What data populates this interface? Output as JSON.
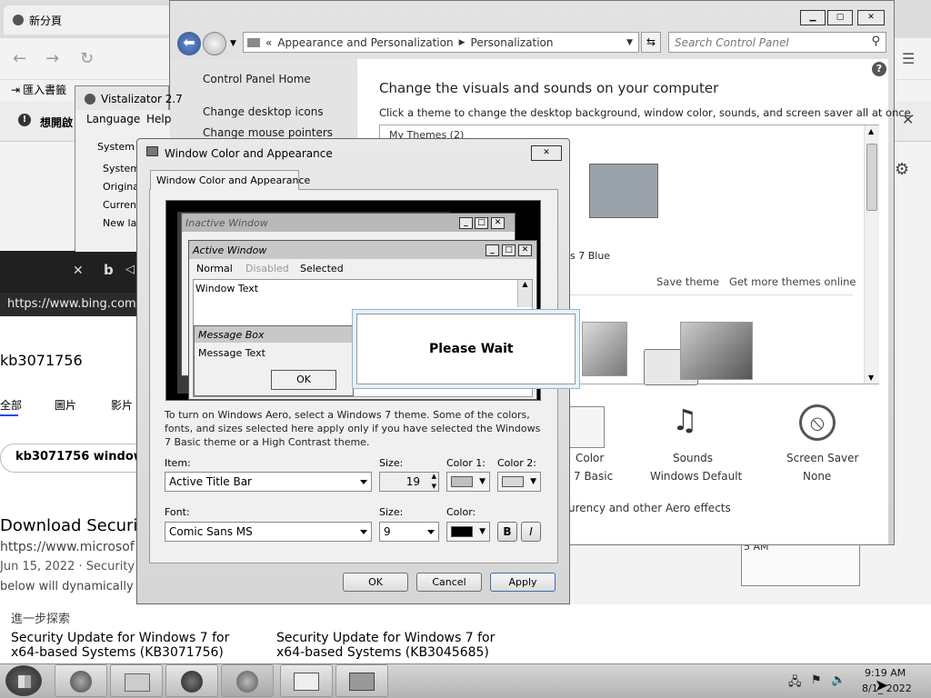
{
  "browser": {
    "tab_title": "新分頁",
    "import_bookmarks": "匯入書籤",
    "notice": "想開啟",
    "address_bar": "https://www.bing.com/",
    "search_query": "kb3071756",
    "tabs": [
      "全部",
      "圖片",
      "影片"
    ],
    "related_pill": "kb3071756 windows",
    "result_title": "Download Securit",
    "result_url": "https://www.microsof",
    "result_date": "Jun 15, 2022 · Security U",
    "result_snippet": "below will dynamically ch",
    "explore_label": "進一步探索",
    "links": [
      "Security Update for Windows 7 for x64-based Systems (KB3071756)",
      "Security Update for Windows 7 for x64-based Systems (KB3045685)"
    ]
  },
  "vistalizator": {
    "title": "Vistalizator 2.7",
    "menu": [
      "Language",
      "Help"
    ],
    "group_label": "System c",
    "rows": [
      "System:",
      "Origina",
      "Current",
      "New lan"
    ]
  },
  "control_panel": {
    "breadcrumb": [
      "Appearance and Personalization",
      "Personalization"
    ],
    "search_placeholder": "Search Control Panel",
    "sidebar": [
      "Control Panel Home",
      "Change desktop icons",
      "Change mouse pointers"
    ],
    "heading": "Change the visuals and sounds on your computer",
    "description": "Click a theme to change the desktop background, window color, sounds, and screen saver all at once.",
    "my_themes": "My Themes (2)",
    "theme_name": "ws 7 Blue",
    "save_theme": "Save theme",
    "get_more": "Get more themes online",
    "bottom_items": [
      {
        "label": "Color",
        "sub": "7 Basic"
      },
      {
        "label": "Sounds",
        "sub": "Windows Default"
      },
      {
        "label": "Screen Saver",
        "sub": "None"
      }
    ],
    "transparency": "urency and other Aero effects",
    "back_window_time": "5 AM"
  },
  "dialog": {
    "title": "Window Color and Appearance",
    "tab": "Window Color and Appearance",
    "preview": {
      "inactive": "Inactive Window",
      "active": "Active Window",
      "menu": [
        "Normal",
        "Disabled",
        "Selected"
      ],
      "window_text": "Window Text",
      "message_box": "Message Box",
      "message_text": "Message Text",
      "ok": "OK"
    },
    "help_text": "To turn on Windows Aero, select a Windows 7 theme.  Some of the colors, fonts, and sizes selected here apply only if you have selected the Windows 7 Basic theme or a High Contrast theme.",
    "item_label": "Item:",
    "item_value": "Active Title Bar",
    "size_label": "Size:",
    "size_value": "19",
    "color1_label": "Color 1:",
    "color2_label": "Color 2:",
    "font_label": "Font:",
    "font_value": "Comic Sans MS",
    "font_size_label": "Size:",
    "font_size_value": "9",
    "font_color_label": "Color:",
    "bold": "B",
    "italic": "I",
    "ok": "OK",
    "cancel": "Cancel",
    "apply": "Apply"
  },
  "please_wait": "Please Wait",
  "taskbar": {
    "time": "9:19 AM",
    "date": "8/1_ 2022"
  },
  "colors": {
    "accent": "#3a6ea5",
    "titlebar_inactive": "#b4b4b4",
    "dialog_face": "#f0f0f0"
  }
}
